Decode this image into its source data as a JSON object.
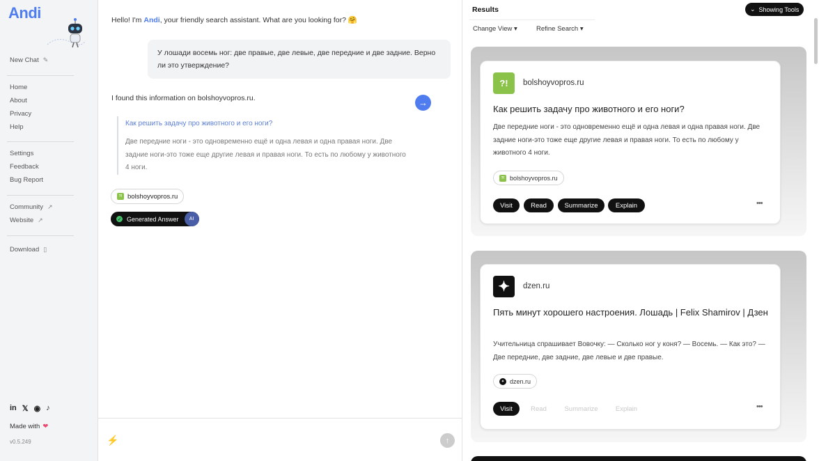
{
  "sidebar": {
    "logo": "Andi",
    "new_chat": "New Chat",
    "nav": [
      "Home",
      "About",
      "Privacy",
      "Help"
    ],
    "settings": [
      "Settings",
      "Feedback",
      "Bug Report"
    ],
    "community": "Community",
    "website": "Website",
    "download": "Download",
    "made_with": "Made with",
    "version": "v0.5.249"
  },
  "chat": {
    "greeting_prefix": "Hello! I'm",
    "greeting_name": "Andi",
    "greeting_suffix": ", your friendly search assistant. What are you looking for? 🤗",
    "user_message": "У лошади восемь ног: две правые, две левые, две передние и две задние. Верно ли это утверждение?",
    "answer_intro": "I found this information on bolshoyvopros.ru.",
    "quote_title": "Как решить задачу про животного и его ноги?",
    "quote_text": "Две передние ноги - это одновременно ещё и одна левая и одна правая ноги. Две задние ноги-это тоже еще другие левая и правая ноги. То есть по любому у животного 4 ноги.",
    "source_chip": "bolshoyvopros.ru",
    "generated_label": "Generated Answer",
    "ai_badge": "AI",
    "input_value": ""
  },
  "results": {
    "title": "Results",
    "tools_button": "Showing Tools",
    "change_view": "Change View",
    "refine_search": "Refine Search",
    "cards": [
      {
        "site": "bolshoyvopros.ru",
        "logo_text": "?!",
        "logo_color": "#8bc34a",
        "title": "Как решить задачу про животного и его ноги?",
        "text": "Две передние ноги - это одновременно ещё и одна левая и одна правая ноги. Две задние ноги-это тоже еще другие левая и правая ноги. То есть по любому у животного 4 ноги.",
        "chip": "bolshoyvopros.ru",
        "actions": [
          "Visit",
          "Read",
          "Summarize",
          "Explain"
        ]
      },
      {
        "site": "dzen.ru",
        "logo_text": "✦",
        "logo_color": "#111111",
        "title": "Пять минут хорошего настроения. Лошадь | Felix Shamirov | Дзен",
        "text": "Учительница спрашивает Вовочку: — Сколько ног у коня? — Восемь. — Как это? — Две передние, две задние, две левые и две правые.",
        "chip": "dzen.ru",
        "actions": [
          "Visit",
          "Read",
          "Summarize",
          "Explain"
        ]
      }
    ]
  },
  "colors": {
    "accent": "#4f7df0",
    "dark": "#111111"
  }
}
